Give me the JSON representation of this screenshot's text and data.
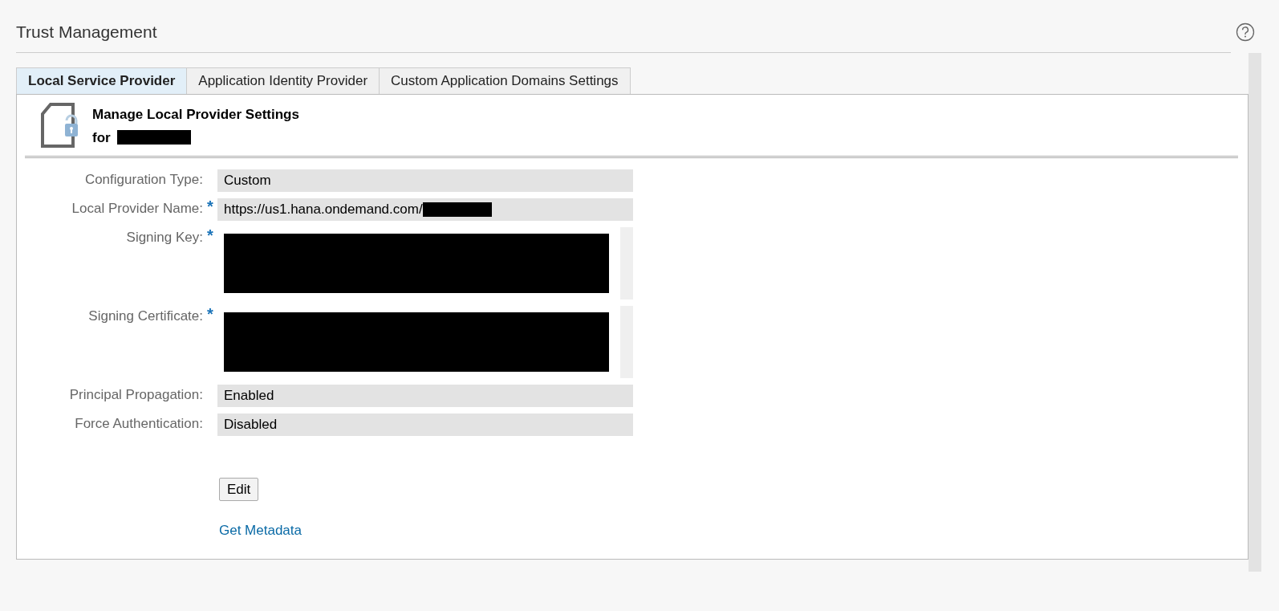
{
  "page": {
    "title": "Trust Management"
  },
  "tabs": [
    {
      "label": "Local Service Provider",
      "selected": true
    },
    {
      "label": "Application Identity Provider",
      "selected": false
    },
    {
      "label": "Custom Application Domains Settings",
      "selected": false
    }
  ],
  "panel": {
    "heading": "Manage Local Provider Settings",
    "subheading": "for",
    "subheading_redacted": true
  },
  "fields": [
    {
      "kind": "text",
      "label": "Configuration Type:",
      "value": "Custom",
      "redacted": false
    },
    {
      "kind": "text",
      "label": "Local Provider Name:",
      "required_mark": "*",
      "value": "https://us1.hana.ondemand.com/",
      "redacted": true
    },
    {
      "kind": "textarea",
      "label": "Signing Key:",
      "required_mark": "*",
      "redacted": true
    },
    {
      "kind": "textarea",
      "label": "Signing Certificate:",
      "required_mark": "*",
      "redacted": true
    },
    {
      "kind": "text",
      "label": "Principal Propagation:",
      "value": "Enabled",
      "redacted": false
    },
    {
      "kind": "text",
      "label": "Force Authentication:",
      "value": "Disabled",
      "redacted": false
    }
  ],
  "buttons": [
    {
      "label": "Edit"
    }
  ],
  "links": [
    {
      "label": "Get Metadata"
    }
  ]
}
